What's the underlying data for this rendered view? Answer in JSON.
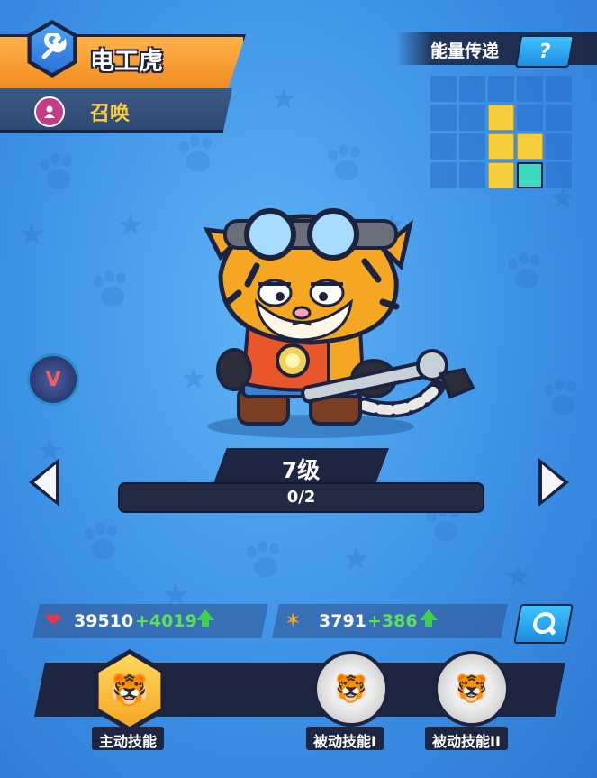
{
  "hero": {
    "name": "电工虎",
    "class_icon": "wrench-icon",
    "type_label": "召唤",
    "type_icon": "summon-icon"
  },
  "energy": {
    "label": "能量传递",
    "help_label": "?",
    "grid": [
      [
        "empty",
        "empty",
        "empty",
        "empty",
        "empty"
      ],
      [
        "empty",
        "empty",
        "yellow",
        "empty",
        "empty"
      ],
      [
        "empty",
        "empty",
        "yellow",
        "yellow",
        "empty"
      ],
      [
        "empty",
        "empty",
        "yellow",
        "teal",
        "empty"
      ]
    ]
  },
  "badge": {
    "label": "V"
  },
  "level": {
    "label": "7级",
    "progress_text": "0/2",
    "progress_fraction": 0
  },
  "stats": {
    "hp": {
      "icon": "heart-icon",
      "value": "39510",
      "bonus": "+4019"
    },
    "atk": {
      "icon": "attack-icon",
      "value": "3791",
      "bonus": "+386"
    }
  },
  "skills": [
    {
      "label": "主动技能",
      "state": "active"
    },
    {
      "label": "被动技能I",
      "state": "locked"
    },
    {
      "label": "被动技能II",
      "state": "locked"
    }
  ],
  "colors": {
    "background": "#3d92e6",
    "name_banner": "#f5a030",
    "type_text": "#ffcc3d",
    "bonus_green": "#5ee05a",
    "energy_yellow": "#f7cf3e",
    "energy_teal": "#3fd9c2"
  }
}
